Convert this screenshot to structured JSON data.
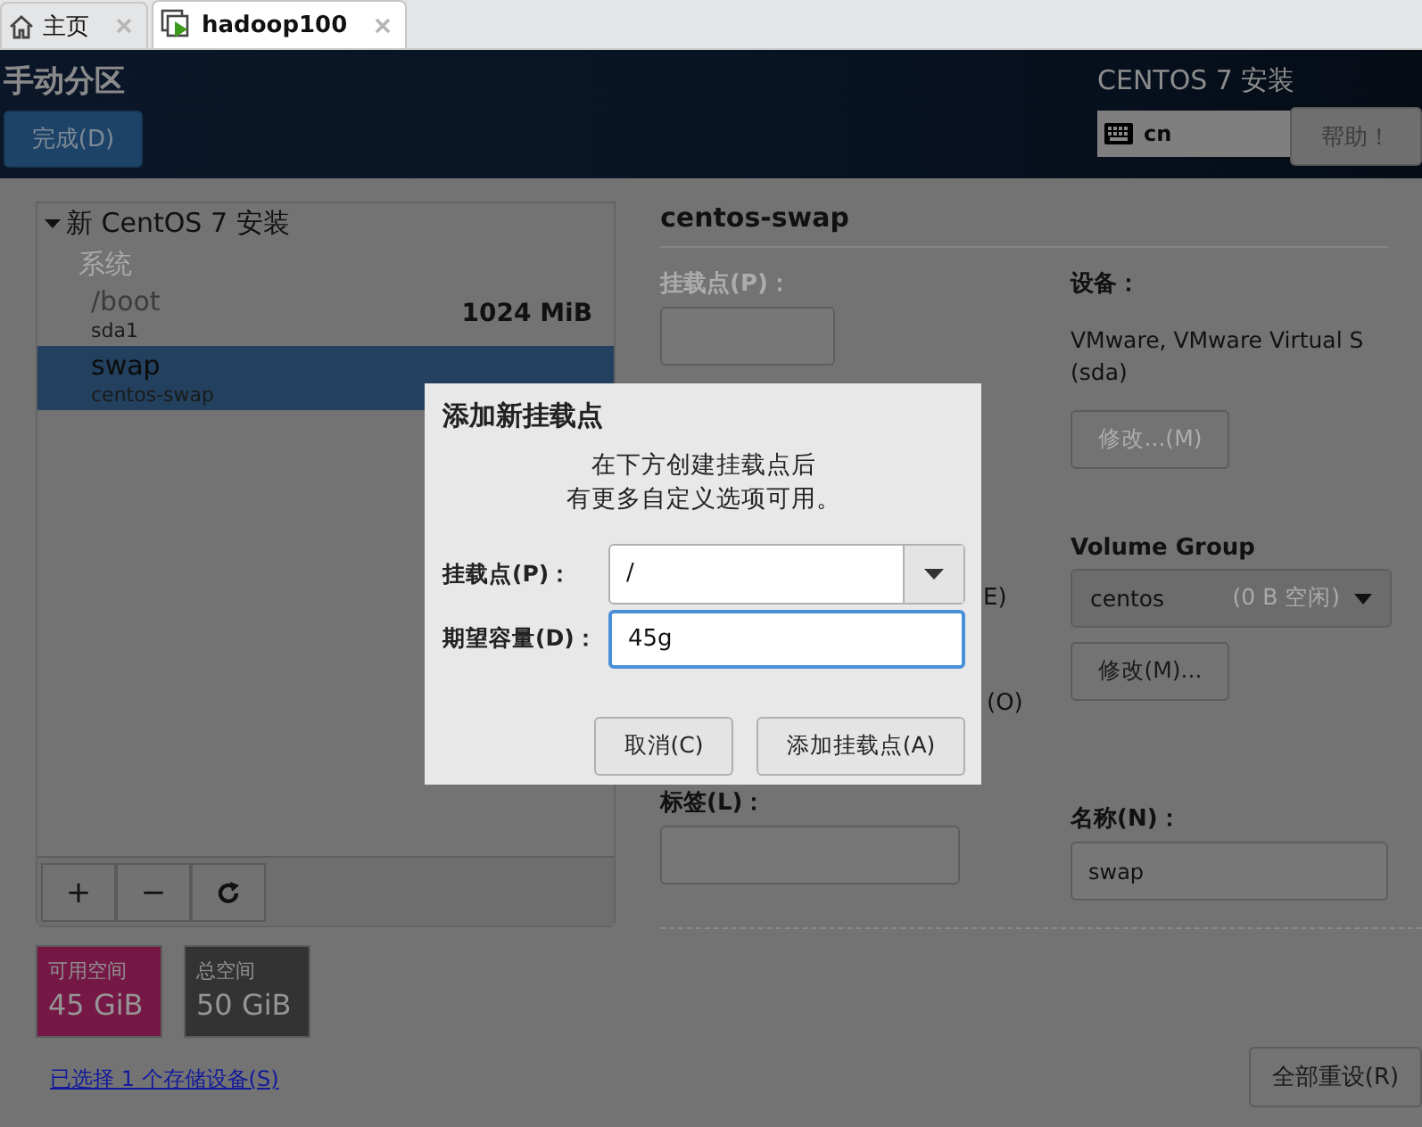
{
  "tabs": [
    {
      "label": "主页",
      "kind": "home",
      "selected": false
    },
    {
      "label": "hadoop100",
      "kind": "vm",
      "selected": true
    }
  ],
  "header": {
    "title": "手动分区",
    "done_button": "完成(D)",
    "product": "CENTOS 7 安装",
    "keyboard": "cn",
    "help_button": "帮助！"
  },
  "partitions": {
    "group_title": "新 CentOS 7 安装",
    "expanded": true,
    "sections": [
      {
        "label": "系统",
        "items": [
          {
            "mount": "/boot",
            "device": "sda1",
            "size": "1024 MiB",
            "selected": false
          },
          {
            "mount": "swap",
            "device": "centos-swap",
            "selected": true
          }
        ]
      }
    ],
    "toolbar": [
      "+",
      "−"
    ]
  },
  "space": [
    {
      "label": "可用空间",
      "value": "45 GiB",
      "color": "#761845"
    },
    {
      "label": "总空间",
      "value": "50 GiB",
      "color": "#333333"
    }
  ],
  "storage_link": "已选择 1 个存储设备(S)",
  "details": {
    "title": "centos-swap",
    "mount_point": {
      "label": "挂载点(P)：",
      "disabled": true
    },
    "device": {
      "label": "设备：",
      "lines": [
        "VMware, VMware Virtual S",
        "(sda)"
      ]
    },
    "modify_device": {
      "label": "修改...(M)",
      "disabled": true
    },
    "fragments": [
      "E)",
      "(O)"
    ],
    "volume_group": {
      "label": "Volume Group",
      "value": "centos",
      "free": "(0 B 空闲)"
    },
    "modify_group": {
      "label": "修改(M)...",
      "disabled": false
    },
    "label_field": {
      "label": "标签(L)："
    },
    "name_field": {
      "label": "名称(N)：",
      "value": "swap"
    },
    "reset_button": "全部重设(R)"
  },
  "dialog": {
    "title": "添加新挂载点",
    "message": [
      "在下方创建挂载点后",
      "有更多自定义选项可用。"
    ],
    "mount_point": {
      "label": "挂载点(P)：",
      "value": "/"
    },
    "capacity": {
      "label": "期望容量(D)：",
      "value": "45g",
      "focused": true
    },
    "buttons": [
      "取消(C)",
      "添加挂载点(A)"
    ]
  }
}
